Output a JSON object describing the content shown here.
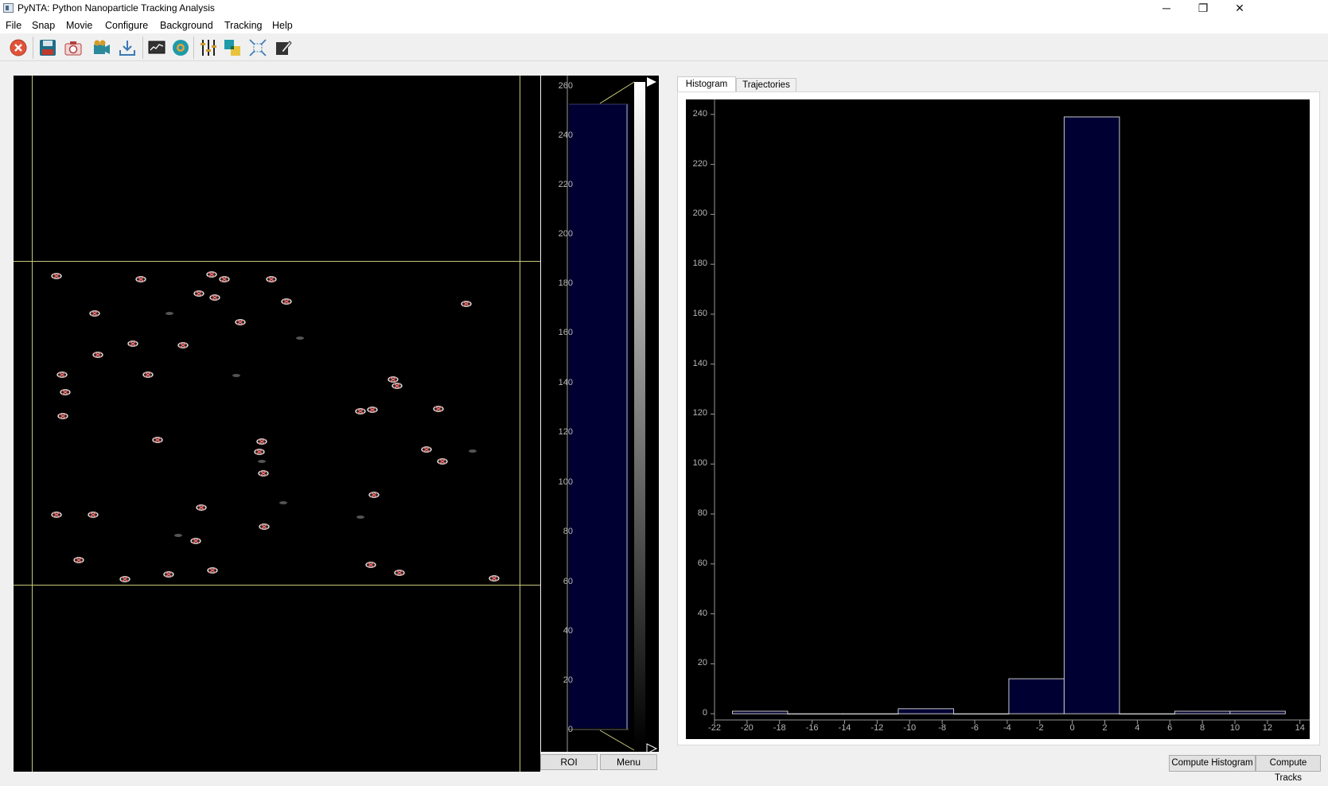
{
  "window": {
    "title": "PyNTA: Python Nanoparticle Tracking Analysis",
    "minimize": "─",
    "restore": "❐",
    "close": "✕"
  },
  "menu": [
    "File",
    "Snap",
    "Movie",
    "Configure",
    "Background",
    "Tracking",
    "Help"
  ],
  "toolbar": [
    {
      "icon": "stop-icon"
    },
    {
      "icon": "save-icon"
    },
    {
      "icon": "snap-camera-icon"
    },
    {
      "icon": "movie-camera-icon"
    },
    {
      "icon": "download-icon"
    },
    {
      "icon": "monitor-icon"
    },
    {
      "icon": "globe-icon"
    },
    {
      "icon": "sliders-icon"
    },
    {
      "icon": "background-icon"
    },
    {
      "icon": "roi-expand-icon"
    },
    {
      "icon": "edit-icon"
    }
  ],
  "lut": {
    "ticks": [
      "260",
      "240",
      "220",
      "200",
      "180",
      "160",
      "140",
      "120",
      "100",
      "80",
      "60",
      "40",
      "20",
      "0"
    ],
    "roi_label": "ROI",
    "menu_label": "Menu"
  },
  "tabs": [
    {
      "label": "Histogram",
      "active": true
    },
    {
      "label": "Trajectories",
      "active": false
    }
  ],
  "buttons": {
    "compute_histogram": "Compute Histogram",
    "compute_tracks": "Compute Tracks"
  },
  "chart_data": {
    "type": "bar",
    "title": "",
    "xlabel": "",
    "ylabel": "",
    "x_ticks": [
      "-22",
      "-20",
      "-18",
      "-16",
      "-14",
      "-12",
      "-10",
      "-8",
      "-6",
      "-4",
      "-2",
      "0",
      "2",
      "4",
      "6",
      "8",
      "10",
      "12",
      "14"
    ],
    "y_ticks": [
      "240",
      "220",
      "200",
      "180",
      "160",
      "140",
      "120",
      "100",
      "80",
      "60",
      "40",
      "20",
      "0"
    ],
    "xlim": [
      -22,
      14.6
    ],
    "ylim": [
      -2.5,
      246
    ],
    "bin_edges": [
      -20.9,
      -17.5,
      -14.1,
      -10.7,
      -7.3,
      -3.9,
      -0.5,
      2.9,
      6.3,
      9.7,
      13.1
    ],
    "counts": [
      1,
      0,
      0,
      2,
      0,
      14,
      239,
      0,
      1,
      1
    ],
    "bar_fill": "#000033",
    "bar_stroke": "#c8c8c8",
    "background": "#000000",
    "grid": false
  },
  "colors": {
    "roi_lines": "#c8c87a",
    "particle_marker": "#ff5a5a",
    "lut_fill": "#000033"
  }
}
